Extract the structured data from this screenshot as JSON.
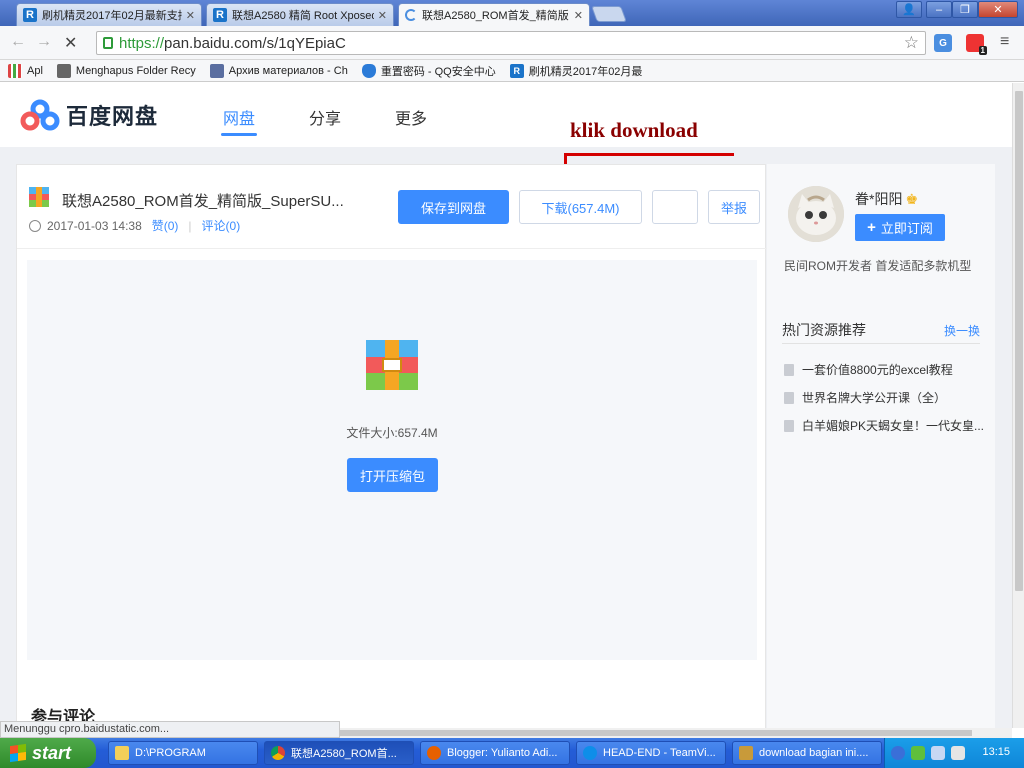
{
  "browser": {
    "tabs": [
      {
        "label": "刷机精灵2017年02月最新支持",
        "icon": "R"
      },
      {
        "label": "联想A2580 精简 Root Xposed",
        "icon": "R"
      },
      {
        "label": "联想A2580_ROM首发_精简版",
        "icon": "loading"
      }
    ],
    "url_scheme": "https://",
    "url_rest": "pan.baidu.com/s/1qYEpiaC",
    "extension_badge": "1",
    "bookmarks": [
      {
        "label": "Apl",
        "icon": "apps-grid-icon"
      },
      {
        "label": "Menghapus Folder Recy",
        "icon": "page-icon"
      },
      {
        "label": "Архив материалов - Ch",
        "icon": "site-icon"
      },
      {
        "label": "重置密码 - QQ安全中心",
        "icon": "shield-icon"
      },
      {
        "label": "刷机精灵2017年02月最",
        "icon": "R"
      }
    ]
  },
  "header": {
    "logo_text": "百度网盘",
    "nav": [
      "网盘",
      "分享",
      "更多"
    ],
    "active_nav": 0
  },
  "annotation": {
    "text": "klik download",
    "color": "#8a0000"
  },
  "file": {
    "name": "联想A2580_ROM首发_精简版_SuperSU...",
    "date": "2017-01-03 14:38",
    "likes": "赞(0)",
    "comments": "评论(0)",
    "save_label": "保存到网盘",
    "download_label": "下载(657.4M)",
    "report_label": "举报",
    "size_text": "文件大小:657.4M",
    "open_label": "打开压缩包"
  },
  "comments_title": "参与评论",
  "sidebar": {
    "username": "眷*阳阳",
    "subscribe_label": "立即订阅",
    "bio": "民间ROM开发者 首发适配多款机型",
    "hot_title": "热门资源推荐",
    "hot_refresh": "换一换",
    "hot_items": [
      "一套价值8800元的excel教程",
      "世界名牌大学公开课（全）",
      "白羊媚娘PK天蝎女皇！一代女皇..."
    ]
  },
  "status_text": "Menunggu cpro.baidustatic.com...",
  "taskbar": {
    "start_label": "start",
    "items": [
      "D:\\PROGRAM",
      "联想A2580_ROM首...",
      "Blogger: Yulianto Adi...",
      "HEAD-END - TeamVi...",
      "download bagian ini...."
    ],
    "clock": "13:15"
  },
  "colors": {
    "accent": "#3b8cff",
    "annotation_red": "#d40000"
  }
}
